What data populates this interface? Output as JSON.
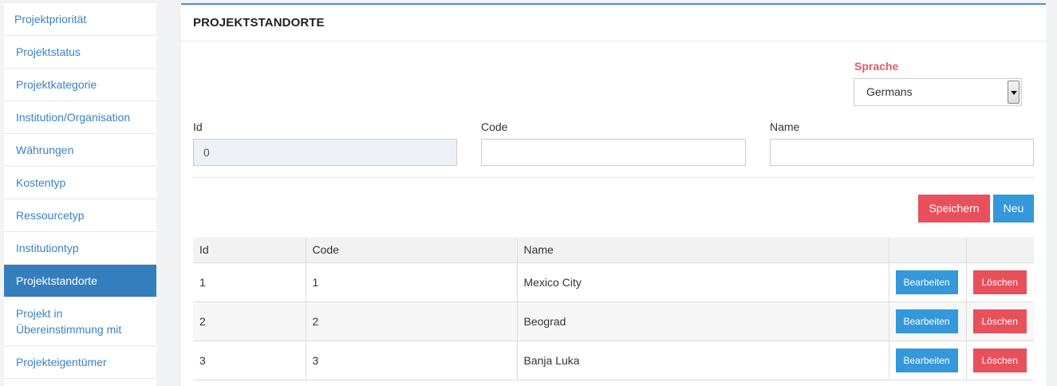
{
  "sidebar": {
    "items": [
      {
        "label": "Projektpriorität"
      },
      {
        "label": "Projektstatus"
      },
      {
        "label": "Projektkategorie"
      },
      {
        "label": "Institution/Organisation"
      },
      {
        "label": "Währungen"
      },
      {
        "label": "Kostentyp"
      },
      {
        "label": "Ressourcetyp"
      },
      {
        "label": "Institutiontyp"
      },
      {
        "label": "Projektstandorte",
        "active": true
      },
      {
        "label": "Projekt in Übereinstimmung mit"
      },
      {
        "label": "Projekteigentümer"
      }
    ]
  },
  "panel": {
    "title": "PROJEKTSTANDORTE"
  },
  "language": {
    "label": "Sprache",
    "selected": "Germans"
  },
  "form": {
    "id_label": "Id",
    "id_value": "0",
    "code_label": "Code",
    "code_value": "",
    "name_label": "Name",
    "name_value": ""
  },
  "buttons": {
    "save": "Speichern",
    "new": "Neu"
  },
  "table": {
    "headers": [
      "Id",
      "Code",
      "Name",
      "",
      ""
    ],
    "rows": [
      {
        "id": "1",
        "code": "1",
        "name": "Mexico City",
        "edit": "Bearbeiten",
        "delete": "Löschen"
      },
      {
        "id": "2",
        "code": "2",
        "name": "Beograd",
        "edit": "Bearbeiten",
        "delete": "Löschen"
      },
      {
        "id": "3",
        "code": "3",
        "name": "Banja Luka",
        "edit": "Bearbeiten",
        "delete": "Löschen"
      }
    ]
  },
  "colors": {
    "accent_blue": "#357ebd",
    "danger_red": "#e8505b",
    "link_blue": "#3a82c4"
  }
}
